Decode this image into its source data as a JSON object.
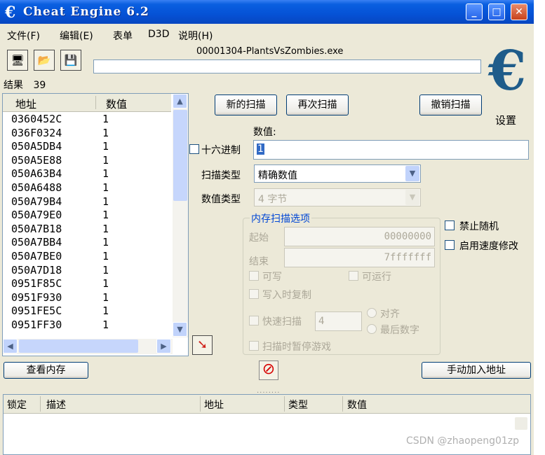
{
  "window": {
    "title": "Cheat Engine 6.2",
    "logo_glyph": "€",
    "controls": {
      "minimize": "_",
      "maximize": "□",
      "close": "✕"
    }
  },
  "menu": [
    "文件(F)",
    "编辑(E)",
    "表单",
    "D3D",
    "说明(H)"
  ],
  "toolbar": {
    "icons": [
      "computer-icon",
      "open-folder-icon",
      "save-icon"
    ],
    "process": "00001304-PlantsVsZombies.exe"
  },
  "results": {
    "label": "结果",
    "count": "39"
  },
  "address_list": {
    "columns": [
      "地址",
      "数值"
    ],
    "rows": [
      {
        "address": "0360452C",
        "value": "1"
      },
      {
        "address": "036F0324",
        "value": "1"
      },
      {
        "address": "050A5DB4",
        "value": "1"
      },
      {
        "address": "050A5E88",
        "value": "1"
      },
      {
        "address": "050A63B4",
        "value": "1"
      },
      {
        "address": "050A6488",
        "value": "1"
      },
      {
        "address": "050A79B4",
        "value": "1"
      },
      {
        "address": "050A79E0",
        "value": "1"
      },
      {
        "address": "050A7B18",
        "value": "1"
      },
      {
        "address": "050A7BB4",
        "value": "1"
      },
      {
        "address": "050A7BE0",
        "value": "1"
      },
      {
        "address": "050A7D18",
        "value": "1"
      },
      {
        "address": "0951F85C",
        "value": "1"
      },
      {
        "address": "0951F930",
        "value": "1"
      },
      {
        "address": "0951FE5C",
        "value": "1"
      },
      {
        "address": "0951FF30",
        "value": "1"
      }
    ]
  },
  "scan": {
    "new_scan": "新的扫描",
    "next_scan": "再次扫描",
    "undo_scan": "撤销扫描",
    "settings": "设置",
    "value_label": "数值:",
    "value": "1",
    "hex_label": "十六进制",
    "scan_type_label": "扫描类型",
    "scan_type": "精确数值",
    "value_type_label": "数值类型",
    "value_type": "4 字节"
  },
  "memory_options": {
    "title": "内存扫描选项",
    "start_label": "起始",
    "start": "00000000",
    "stop_label": "结束",
    "stop": "7fffffff",
    "writable": "可写",
    "executable": "可运行",
    "copy_on_write": "写入时复制",
    "fast_scan": "快速扫描",
    "fast_scan_value": "4",
    "align": "对齐",
    "last_digits": "最后数字",
    "pause_game": "扫描时暂停游戏"
  },
  "options": {
    "disable_random": "禁止随机",
    "speedhack": "启用速度修改"
  },
  "bottom": {
    "view_memory": "查看内存",
    "add_address": "手动加入地址",
    "columns": [
      "锁定",
      "描述",
      "地址",
      "类型",
      "数值"
    ]
  },
  "watermark": "CSDN @zhaopeng01zp"
}
